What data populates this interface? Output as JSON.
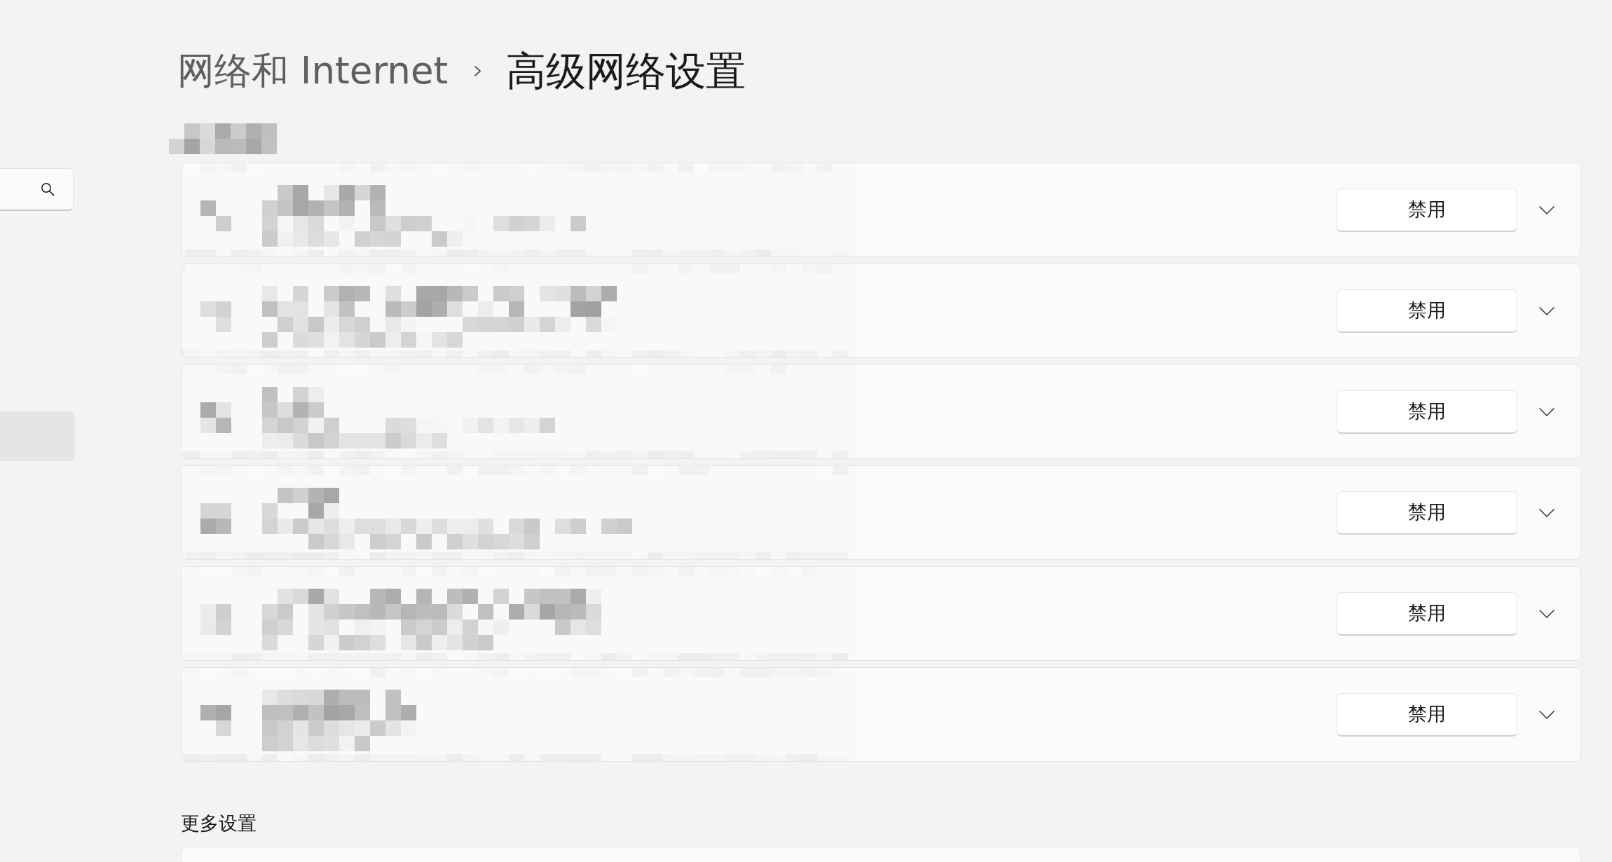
{
  "breadcrumb": {
    "parent": "网络和 Internet",
    "current": "高级网络设置"
  },
  "sidebar": {
    "items": [
      {
        "selected": true
      }
    ]
  },
  "adapters": [
    {
      "button": "禁用",
      "expanded": false
    },
    {
      "button": "禁用",
      "expanded": false
    },
    {
      "button": "禁用",
      "expanded": false
    },
    {
      "button": "禁用",
      "expanded": false
    },
    {
      "button": "禁用",
      "expanded": false
    },
    {
      "button": "禁用",
      "expanded": false
    }
  ],
  "more_settings": {
    "title": "更多设置"
  }
}
